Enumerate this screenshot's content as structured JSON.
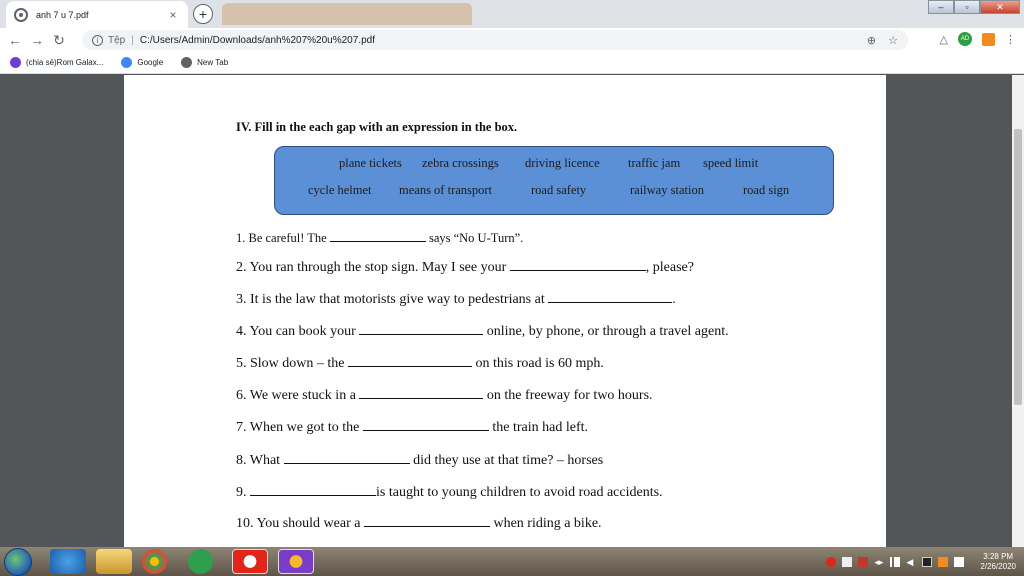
{
  "browser": {
    "tab_title": "anh 7 u 7.pdf",
    "tab_close": "×",
    "new_tab": "+",
    "url_protocol": "Tệp",
    "url": "C:/Users/Admin/Downloads/anh%207%20u%207.pdf",
    "avatar_text": "AD",
    "menu_glyph": "⋮"
  },
  "bookmarks": [
    {
      "label": "(chia sẻ)Rom Galax...",
      "color": "#6b3fd1"
    },
    {
      "label": "Google",
      "color": "#4285f4"
    },
    {
      "label": "New Tab",
      "color": "#5f6368"
    }
  ],
  "document": {
    "heading": "IV. Fill in the each gap with an expression in the box.",
    "word_box": {
      "row1": [
        "plane tickets",
        "zebra crossings",
        "driving licence",
        "traffic jam",
        "speed limit"
      ],
      "row2": [
        "cycle helmet",
        "means of transport",
        "road safety",
        "railway station",
        "road sign"
      ]
    },
    "questions": [
      {
        "before": "1. Be careful! The ",
        "after": " says “No U-Turn”."
      },
      {
        "before": "2. You ran through the stop sign. May I see your ",
        "after": ", please?"
      },
      {
        "before": "3. It is the law that motorists give way to pedestrians at ",
        "after": "."
      },
      {
        "before": "4. You can book your ",
        "after": " online, by phone, or through a travel agent."
      },
      {
        "before": "5. Slow down – the ",
        "after": " on this road is 60 mph."
      },
      {
        "before": "6. We were stuck in a ",
        "after": " on the freeway for two hours."
      },
      {
        "before": "7. When we got to the ",
        "after": " the train had left."
      },
      {
        "before": "8. What ",
        "after": " did they use at that time? – horses"
      },
      {
        "before": "9. ",
        "after": "is taught to young children to avoid road accidents."
      },
      {
        "before": "10. You should wear a ",
        "after": " when riding a bike."
      }
    ]
  },
  "taskbar": {
    "time": "3:28 PM",
    "date": "2/26/2020"
  }
}
